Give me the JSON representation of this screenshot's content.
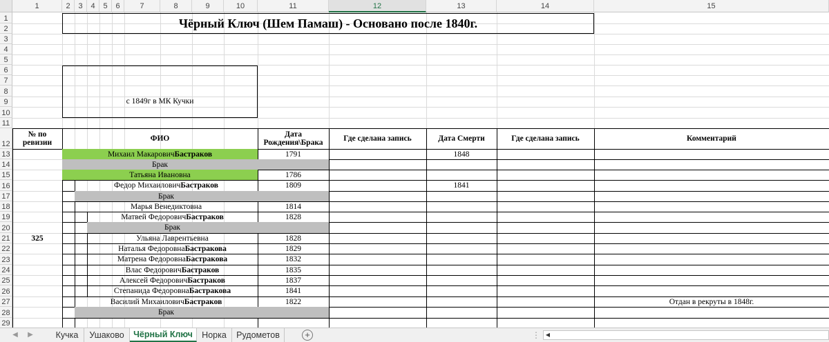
{
  "column_headers": [
    "1",
    "2",
    "3",
    "4",
    "5",
    "6",
    "7",
    "8",
    "9",
    "10",
    "11",
    "12",
    "13",
    "14",
    "15"
  ],
  "selected_column": "12",
  "row_headers": [
    "1",
    "2",
    "3",
    "4",
    "5",
    "6",
    "7",
    "8",
    "9",
    "10",
    "11",
    "12",
    "13",
    "14",
    "15",
    "16",
    "17",
    "18",
    "19",
    "20",
    "21",
    "22",
    "23",
    "24",
    "25",
    "26",
    "27",
    "28",
    "29"
  ],
  "title": "Чёрный Ключ (Шем Памаш) - Основано после 1840г.",
  "note": "с 1849г  в МК Кучки",
  "table_headers": {
    "revision_line1": "№ по",
    "revision_line2": "ревизии",
    "fio": "ФИО",
    "date_line1": "Дата",
    "date_line2": "Рождения\\Брака",
    "record_place": "Где сделана запись",
    "death_date": "Дата Смерти",
    "record_place2": "Где сделана запись",
    "comment": "Комментарий"
  },
  "revision_number": "325",
  "rows": [
    {
      "name": "Михаил Макарович ",
      "surname": "Бастраков",
      "date": "1791",
      "death": "1848",
      "comment": ""
    },
    {
      "name": "Брак",
      "surname": "",
      "date": "",
      "death": "",
      "comment": ""
    },
    {
      "name": "Татьяна Ивановна",
      "surname": "",
      "date": "1786",
      "death": "",
      "comment": ""
    },
    {
      "name": "Федор Михаилович ",
      "surname": "Бастраков",
      "date": "1809",
      "death": "1841",
      "comment": ""
    },
    {
      "name": "Брак",
      "surname": "",
      "date": "",
      "death": "",
      "comment": ""
    },
    {
      "name": "Марья Венедиктовна",
      "surname": "",
      "date": "1814",
      "death": "",
      "comment": ""
    },
    {
      "name": "Матвей Федорович ",
      "surname": "Бастраков",
      "date": "1828",
      "death": "",
      "comment": ""
    },
    {
      "name": "Брак",
      "surname": "",
      "date": "",
      "death": "",
      "comment": ""
    },
    {
      "name": "Ульяна Лаврентьевна",
      "surname": "",
      "date": "1828",
      "death": "",
      "comment": ""
    },
    {
      "name": "Наталья Федоровна ",
      "surname": "Бастракова",
      "date": "1829",
      "death": "",
      "comment": ""
    },
    {
      "name": "Матрена Федоровна ",
      "surname": "Бастракова",
      "date": "1832",
      "death": "",
      "comment": ""
    },
    {
      "name": "Влас Федорович ",
      "surname": "Бастраков",
      "date": "1835",
      "death": "",
      "comment": ""
    },
    {
      "name": "Алексей Федорович ",
      "surname": "Бастраков",
      "date": "1837",
      "death": "",
      "comment": ""
    },
    {
      "name": "Степанида Федоровна ",
      "surname": "Бастракова",
      "date": "1841",
      "death": "",
      "comment": ""
    },
    {
      "name": "Василий Михаилович ",
      "surname": "Бастраков",
      "date": "1822",
      "death": "",
      "comment": "Отдан в рекруты в 1848г."
    },
    {
      "name": "Брак",
      "surname": "",
      "date": "",
      "death": "",
      "comment": ""
    },
    {
      "name": "",
      "surname": "",
      "date": "",
      "death": "",
      "comment": ""
    }
  ],
  "sheet_tabs": [
    {
      "label": "Кучка",
      "active": false
    },
    {
      "label": "Ушаково",
      "active": false
    },
    {
      "label": "Чёрный Ключ",
      "active": true
    },
    {
      "label": "Норка",
      "active": false
    },
    {
      "label": "Рудометов",
      "active": false
    }
  ],
  "icons": {
    "add_sheet": "plus-circle-icon",
    "nav_prev": "triangle-left-icon",
    "nav_next": "triangle-right-icon",
    "more_tabs": "ellipsis-icon",
    "scroll_left": "triangle-left-icon"
  },
  "colors": {
    "green_fill": "#8ccf4f",
    "gray_fill": "#bfbfbf",
    "active_tab": "#217346"
  }
}
